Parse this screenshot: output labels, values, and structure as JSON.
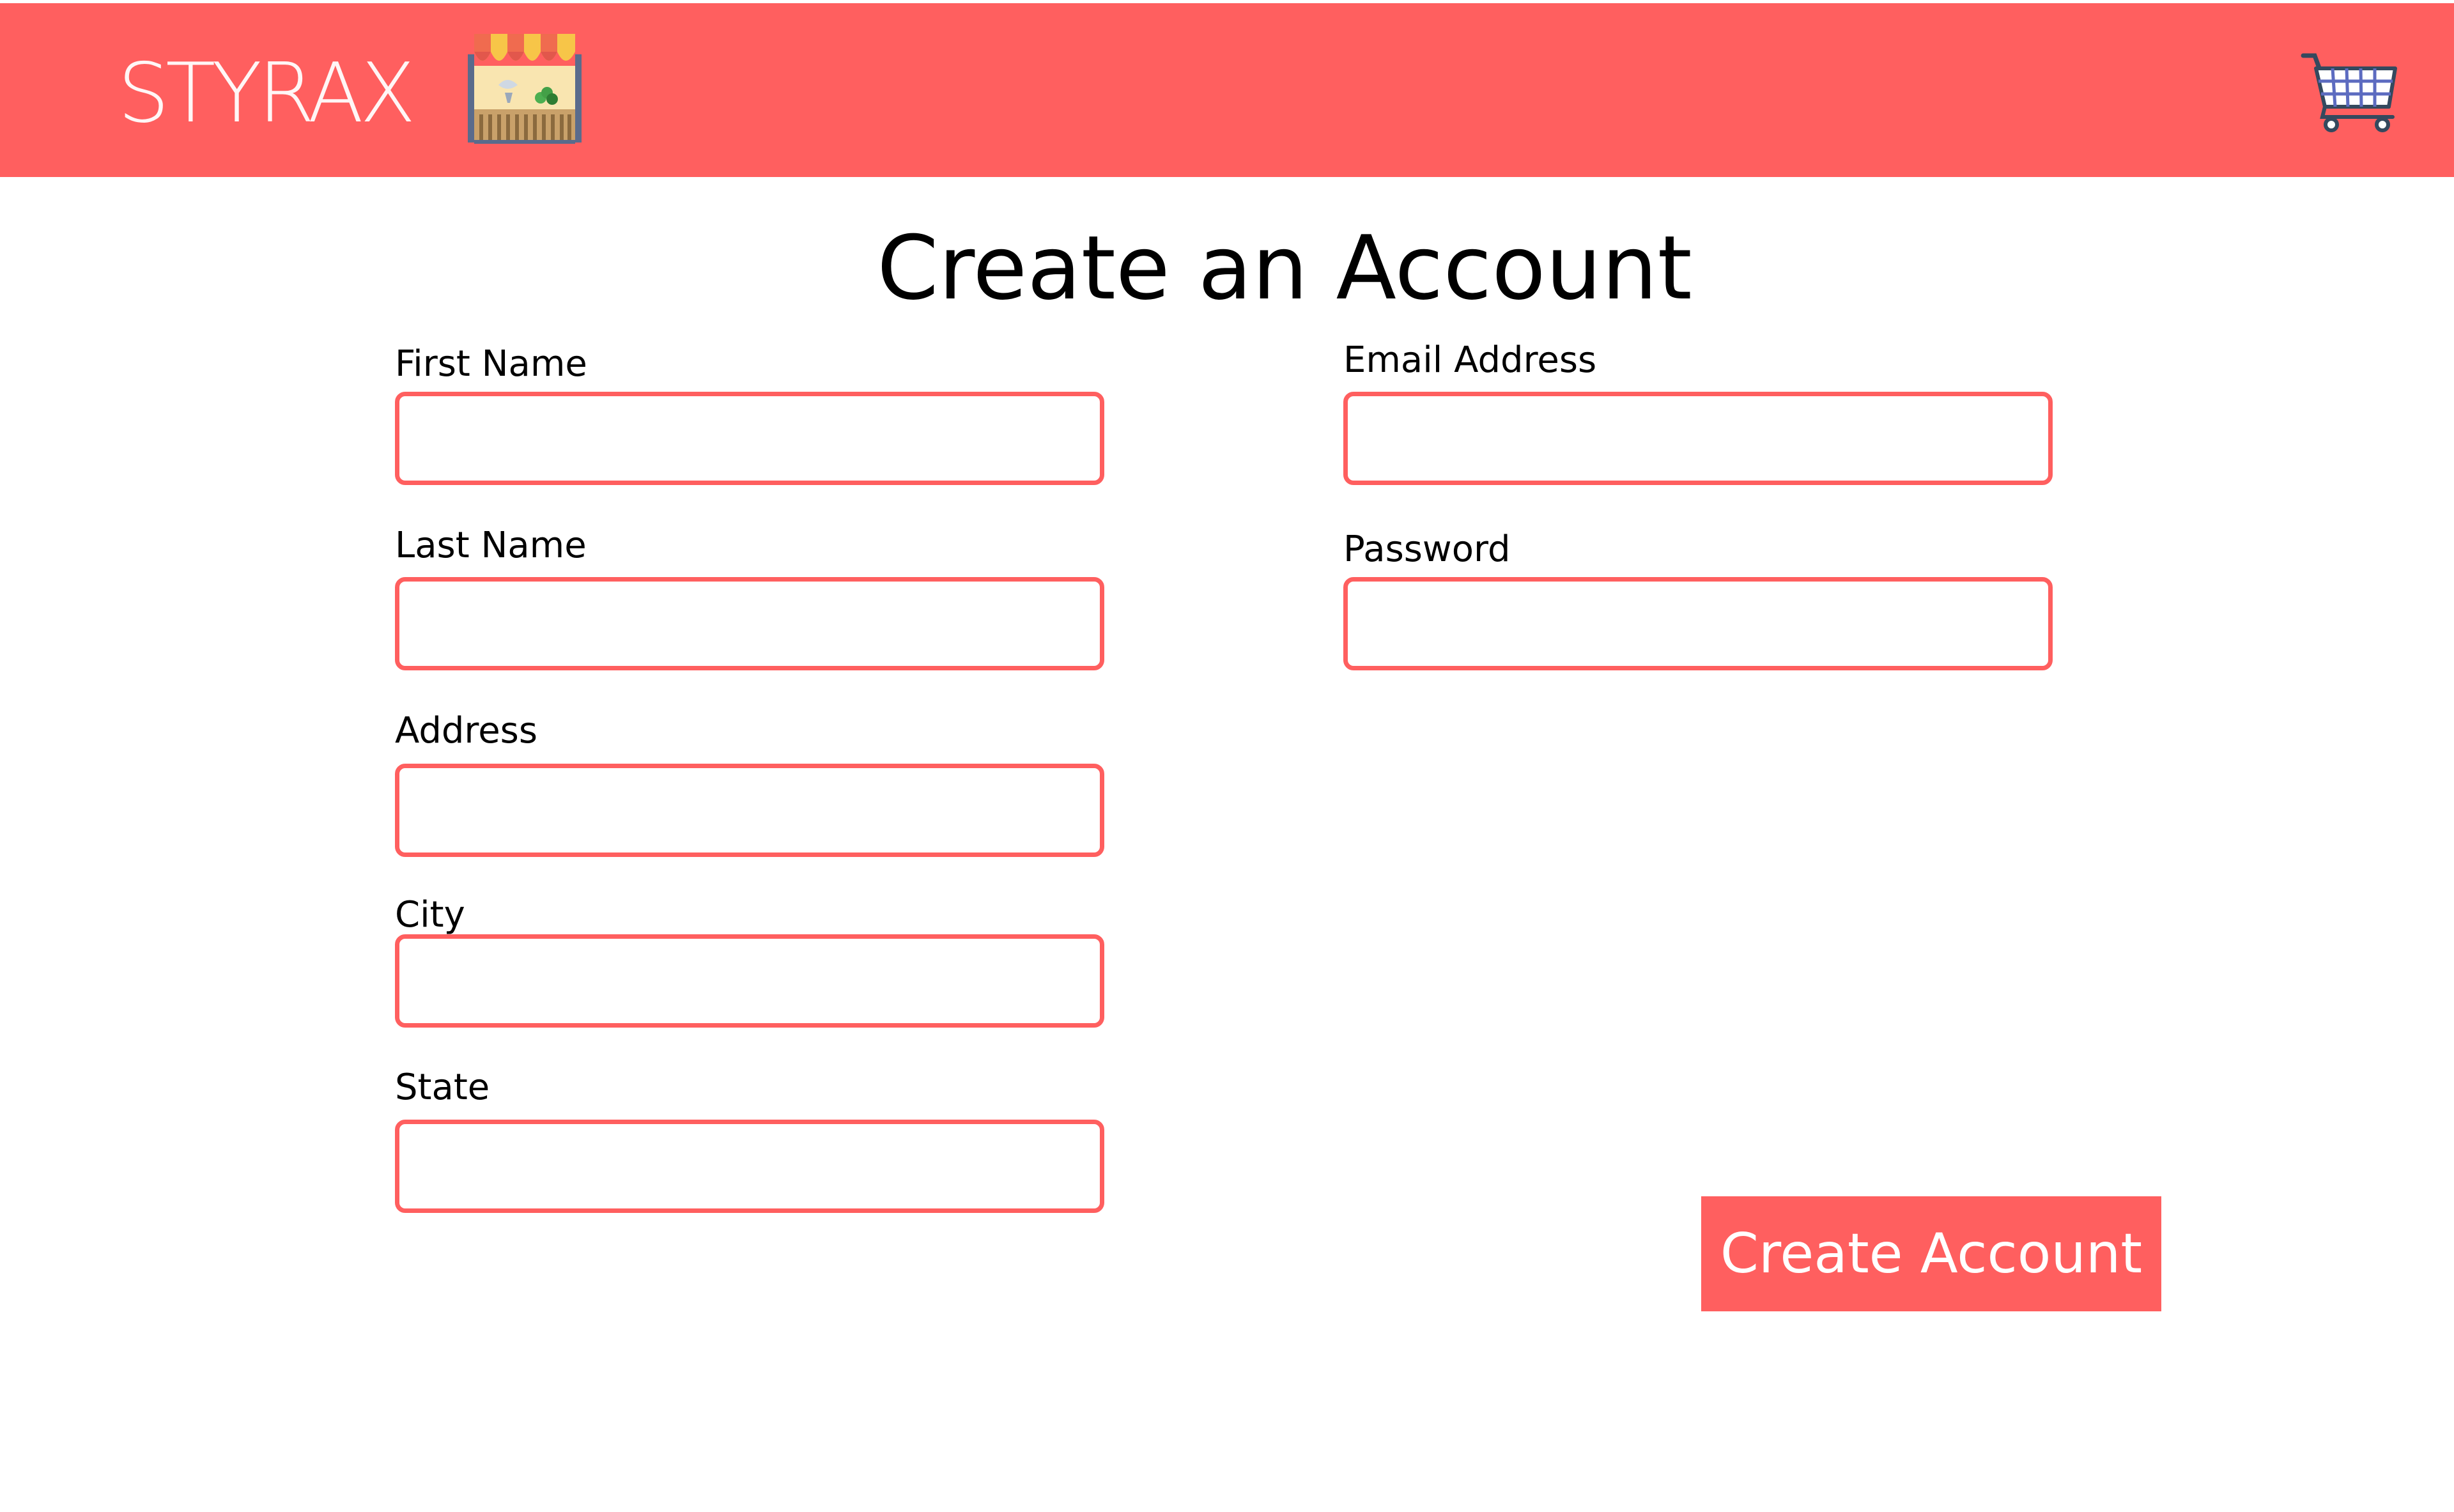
{
  "header": {
    "brand": "STYRAX",
    "store_icon": "market-stall-icon",
    "cart_icon": "shopping-cart-icon",
    "background_color": "#ff5f5f"
  },
  "page": {
    "title": "Create an Account"
  },
  "form": {
    "first_name": {
      "label": "First Name",
      "value": ""
    },
    "last_name": {
      "label": "Last Name",
      "value": ""
    },
    "address": {
      "label": "Address",
      "value": ""
    },
    "city": {
      "label": "City",
      "value": ""
    },
    "state": {
      "label": "State",
      "value": ""
    },
    "email": {
      "label": "Email Address",
      "value": ""
    },
    "password": {
      "label": "Password",
      "value": ""
    },
    "submit_label": "Create Account"
  },
  "colors": {
    "accent": "#ff5f5f",
    "text": "#000000",
    "button_text": "#ffffff"
  }
}
